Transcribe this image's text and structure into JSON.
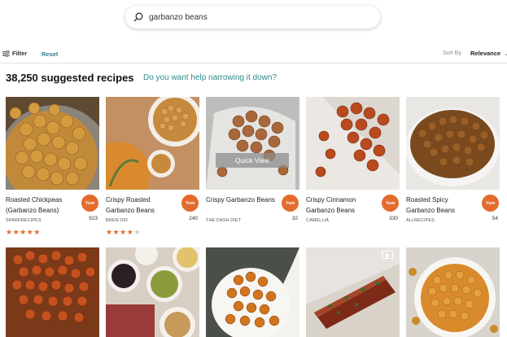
{
  "search": {
    "query": "garbanzo beans"
  },
  "filterbar": {
    "filter_label": "Filter",
    "reset_label": "Reset",
    "sort_label": "Sort By",
    "sort_value": "Relevance"
  },
  "results": {
    "count_text": "38,250 suggested recipes",
    "help_link": "Do you want help narrowing it down?"
  },
  "colors": {
    "accent": "#e46b2c",
    "link": "#2d8c8c"
  },
  "cards": [
    {
      "title": "Roasted Chickpeas (Garbanzo Beans)",
      "source": "SPARKRECIPES",
      "yum_label": "Yum",
      "yum_count": "923",
      "stars": 5
    },
    {
      "title": "Crispy Roasted Garbanzo Beans",
      "source": "BREN DID",
      "yum_label": "Yum",
      "yum_count": "240",
      "stars": 4
    },
    {
      "title": "Crispy Garbanzo Beans",
      "source": "THE DASH DIET",
      "yum_label": "Yum",
      "yum_count": "32",
      "quick_view": "Quick View"
    },
    {
      "title": "Crispy Cinnamon Garbanzo Beans",
      "source": "CAMELLIA",
      "yum_label": "Yum",
      "yum_count": "330"
    },
    {
      "title": "Roasted Spicy Garbanzo Beans",
      "source": "ALLRECIPES",
      "yum_label": "Yum",
      "yum_count": "54"
    }
  ]
}
